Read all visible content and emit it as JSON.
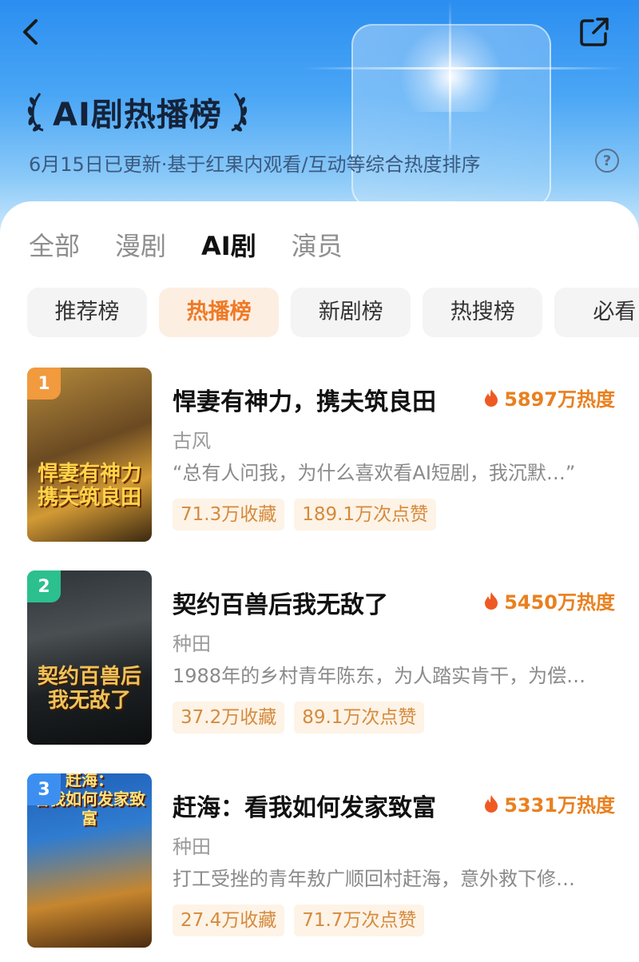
{
  "header": {
    "title": "AI剧热播榜",
    "subtitle": "6月15日已更新·基于红果内观看/互动等综合热度排序",
    "help_label": "?"
  },
  "main_tabs": [
    {
      "label": "全部",
      "active": false
    },
    {
      "label": "漫剧",
      "active": false
    },
    {
      "label": "AI剧",
      "active": true
    },
    {
      "label": "演员",
      "active": false
    }
  ],
  "sub_tabs": [
    {
      "label": "推荐榜",
      "active": false
    },
    {
      "label": "热播榜",
      "active": true
    },
    {
      "label": "新剧榜",
      "active": false
    },
    {
      "label": "热搜榜",
      "active": false
    },
    {
      "label": "必看",
      "active": false
    }
  ],
  "items": [
    {
      "rank": "1",
      "title": "悍妻有神力，携夫筑良田",
      "heat": "5897万热度",
      "genre": "古风",
      "desc": "“总有人问我，为什么喜欢看AI短剧，我沉默…”",
      "favorites": "71.3万收藏",
      "likes": "189.1万次点赞",
      "cover_text": "悍妻有神力\n携夫筑良田",
      "rank_color": "#f19a3e"
    },
    {
      "rank": "2",
      "title": "契约百兽后我无敌了",
      "heat": "5450万热度",
      "genre": "种田",
      "desc": "1988年的乡村青年陈东，为人踏实肯干，为偿…",
      "favorites": "37.2万收藏",
      "likes": "89.1万次点赞",
      "cover_text": "契约百兽后\n我无敌了",
      "rank_color": "#2bc08e"
    },
    {
      "rank": "3",
      "title": "赶海：看我如何发家致富",
      "heat": "5331万热度",
      "genre": "种田",
      "desc": "打工受挫的青年敖广顺回村赶海，意外救下修…",
      "favorites": "27.4万收藏",
      "likes": "71.7万次点赞",
      "cover_text": "赶海：\n看我如何发家致富",
      "rank_color": "#3c8ff0"
    }
  ]
}
